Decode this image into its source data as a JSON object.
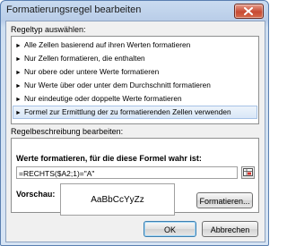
{
  "window": {
    "title": "Formatierungsregel bearbeiten"
  },
  "rule_type": {
    "label": "Regeltyp auswählen:",
    "items": [
      {
        "label": "Alle Zellen basierend auf ihren Werten formatieren"
      },
      {
        "label": "Nur Zellen formatieren, die enthalten"
      },
      {
        "label": "Nur obere oder untere Werte formatieren"
      },
      {
        "label": "Nur Werte über oder unter dem Durchschnitt formatieren"
      },
      {
        "label": "Nur eindeutige oder doppelte Werte formatieren"
      },
      {
        "label": "Formel zur Ermittlung der zu formatierenden Zellen verwenden"
      }
    ],
    "selected_index": 5
  },
  "description": {
    "label": "Regelbeschreibung bearbeiten:",
    "formula_label": "Werte formatieren, für die diese Formel wahr ist:",
    "formula_value": "=RECHTS($A2;1)=\"A\"",
    "preview_label": "Vorschau:",
    "preview_sample": "AaBbCcYyZz",
    "format_button": "Formatieren..."
  },
  "buttons": {
    "ok": "OK",
    "cancel": "Abbrechen"
  },
  "colors": {
    "title_bar": "#c9dbf0",
    "selection": "#d7e6f7",
    "close_button": "#c74a33"
  }
}
